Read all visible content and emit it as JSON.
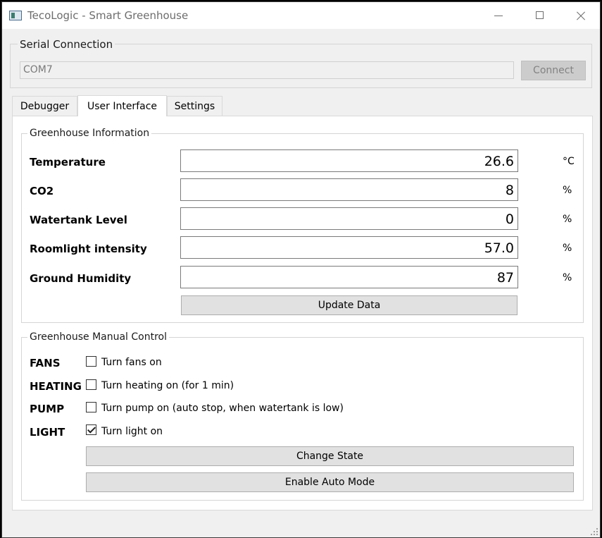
{
  "window": {
    "title": "TecoLogic - Smart Greenhouse"
  },
  "serial": {
    "group_title": "Serial Connection",
    "port_value": "COM7",
    "connect_label": "Connect"
  },
  "tabs": [
    {
      "label": "Debugger",
      "active": false
    },
    {
      "label": "User Interface",
      "active": true
    },
    {
      "label": "Settings",
      "active": false
    }
  ],
  "info": {
    "group_title": "Greenhouse Information",
    "rows": [
      {
        "label": "Temperature",
        "value": "26.6",
        "unit": "°C"
      },
      {
        "label": "CO2",
        "value": "8",
        "unit": "%"
      },
      {
        "label": "Watertank Level",
        "value": "0",
        "unit": "%"
      },
      {
        "label": "Roomlight intensity",
        "value": "57.0",
        "unit": "%"
      },
      {
        "label": "Ground Humidity",
        "value": "87",
        "unit": "%"
      }
    ],
    "update_label": "Update Data"
  },
  "control": {
    "group_title": "Greenhouse Manual Control",
    "items": [
      {
        "label": "FANS",
        "checkbox_text": "Turn fans on",
        "checked": false
      },
      {
        "label": "HEATING",
        "checkbox_text": "Turn heating on (for 1 min)",
        "checked": false
      },
      {
        "label": "PUMP",
        "checkbox_text": "Turn pump on (auto stop, when watertank is low)",
        "checked": false
      },
      {
        "label": "LIGHT",
        "checkbox_text": "Turn light on",
        "checked": true
      }
    ],
    "change_state_label": "Change State",
    "auto_mode_label": "Enable Auto Mode"
  }
}
